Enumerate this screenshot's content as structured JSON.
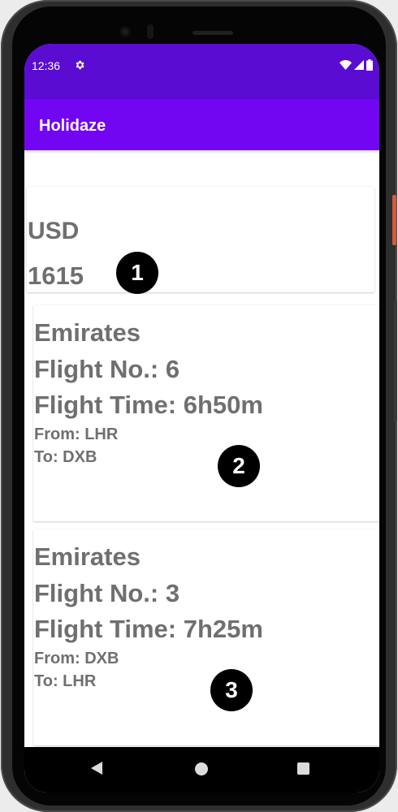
{
  "status_bar": {
    "time": "12:36",
    "icons": [
      "gear-icon",
      "wifi-icon",
      "signal-icon",
      "battery-icon"
    ]
  },
  "app_bar": {
    "title": "Holidaze"
  },
  "currency_card": {
    "currency": "USD",
    "amount": "1615"
  },
  "flights": [
    {
      "airline": "Emirates",
      "flight_no": "Flight No.: 6",
      "flight_time": "Flight Time: 6h50m",
      "from": "From: LHR",
      "to": "To: DXB"
    },
    {
      "airline": "Emirates",
      "flight_no": "Flight No.: 3",
      "flight_time": "Flight Time: 7h25m",
      "from": "From: DXB",
      "to": "To: LHR"
    }
  ],
  "markers": [
    "1",
    "2",
    "3"
  ],
  "nav_bar": {
    "icons": [
      "back-icon",
      "home-icon",
      "recents-icon"
    ]
  },
  "colors": {
    "status_bar": "#5a0cd3",
    "app_bar": "#7206f2",
    "text_gray": "#6f6f6f"
  }
}
